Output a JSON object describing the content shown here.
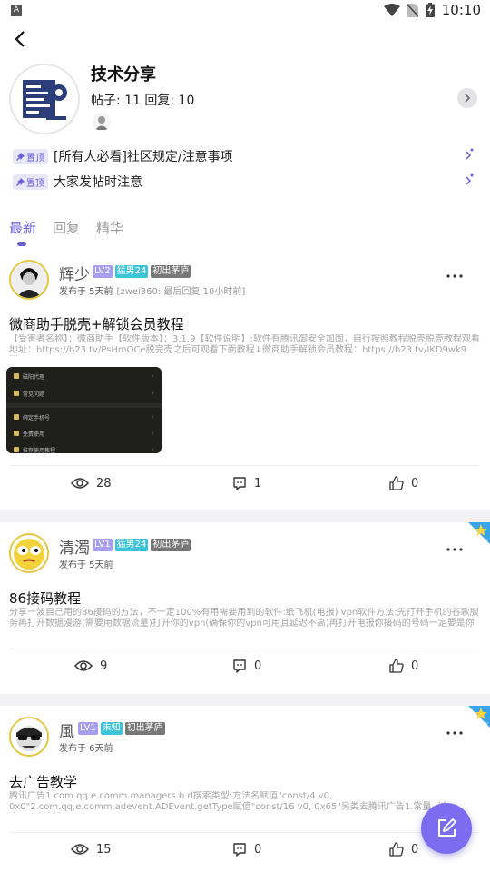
{
  "status_bar": {
    "left_icon": "A",
    "time": "10:10",
    "icons": [
      "wifi-icon",
      "no-sim-icon",
      "battery-charging-icon"
    ]
  },
  "forum": {
    "title": "技术分享",
    "stats": "帖子: 11 回复: 10"
  },
  "pinned": [
    {
      "badge": "置顶",
      "text": "[所有人必看]社区规定/注意事项"
    },
    {
      "badge": "置顶",
      "text": "大家发帖时注意"
    }
  ],
  "tabs": [
    {
      "label": "最新",
      "active": true
    },
    {
      "label": "回复",
      "active": false
    },
    {
      "label": "精华",
      "active": false
    }
  ],
  "posts": [
    {
      "username": "辉少",
      "badges": [
        "LV2",
        "猛男24",
        "初出茅庐"
      ],
      "time": "发布于 5天前",
      "last_reply": "[zwei360: 最后回复 10小时前]",
      "title": "微商助手脱壳+解锁会员教程",
      "summary": "【受害者名称】：微商助手【软件版本】：3.1.9【软件说明】:软件有腾讯御安全加固，自行按照教程脱壳脱壳教程观看地址：https://b23.tv/PsHmOCe脱完壳之后可观看下面教程↓微商助手解锁会员教程：https://b23.tv/IKD9wk9脱...",
      "thumbnail_rows": [
        "磁阳代理",
        "常见问题",
        "绑定手机号",
        "免费使用",
        "推荐使用教程"
      ],
      "views": "28",
      "comments": "1",
      "likes": "0",
      "is_new": false
    },
    {
      "username": "清濁",
      "badges": [
        "LV1",
        "猛男24",
        "初出茅庐"
      ],
      "time": "发布于 5天前",
      "last_reply": "",
      "title": "86接码教程",
      "summary": "分享一波自己用的86接码的方法，不一定100%有用需要用到的软件:纸飞机(电报) vpn软件方法:先打开手机的谷歌服务再打开数据漫游(需要用数据流量)打开你的vpn(确保你的vpn可用且延迟不高)再打开电报你接码的号码一定要是你用...",
      "views": "9",
      "comments": "0",
      "likes": "0",
      "is_new": true,
      "new_label": "NEW"
    },
    {
      "username": "風",
      "badges": [
        "LV1",
        "未知",
        "初出茅庐"
      ],
      "time": "发布于 6天前",
      "last_reply": "",
      "title": "去广告教学",
      "summary": "腾讯广告1.com.qq.e.comm.managers.b.d搜索类型:方法名赋值\"const/4 v0, 0x0\"2.com.qq.e.comm.adevent.ADEvent.getType赋值\"const/16 v0, 0x65\"另类去腾讯广告1.常量--过虑\"...\"点击搜...",
      "views": "15",
      "comments": "0",
      "likes": "0",
      "is_new": true,
      "new_label": "NEW"
    }
  ],
  "colors": {
    "accent": "#6b5fd9",
    "fab": "#7b6cf0",
    "badge_lv": "#a89ef0",
    "badge_cyan": "#3ec4d8",
    "badge_dark": "#777777",
    "avatar_ring": "#e5c542"
  }
}
